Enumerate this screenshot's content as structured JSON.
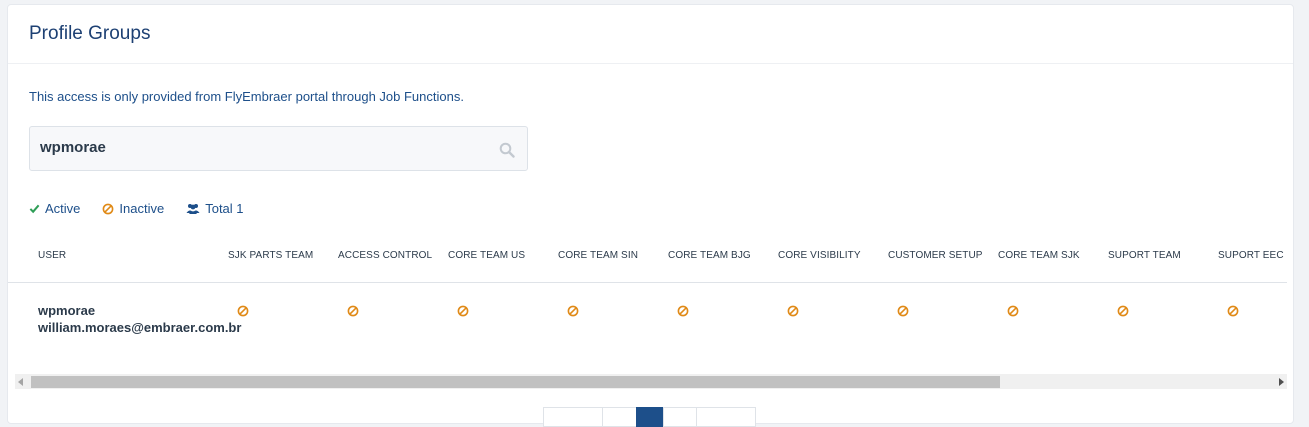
{
  "header": {
    "title": "Profile Groups"
  },
  "notice": "This access is only provided from FlyEmbraer portal through Job Functions.",
  "search": {
    "value": "wpmorae"
  },
  "legend": {
    "active": "Active",
    "inactive": "Inactive",
    "total": "Total 1"
  },
  "colors": {
    "active": "#2f9e57",
    "inactive": "#e08a17",
    "brand": "#1d4073",
    "link": "#1d4f8a"
  },
  "table": {
    "columns": [
      "USER",
      "SJK PARTS TEAM",
      "ACCESS CONTROL",
      "CORE TEAM US",
      "CORE TEAM SIN",
      "CORE TEAM BJG",
      "CORE VISIBILITY",
      "CUSTOMER SETUP",
      "CORE TEAM SJK",
      "SUPORT TEAM",
      "SUPORT EEC"
    ],
    "rows": [
      {
        "user": "wpmorae",
        "email": "william.moraes@embraer.com.br",
        "statuses": [
          "inactive",
          "inactive",
          "inactive",
          "inactive",
          "inactive",
          "inactive",
          "inactive",
          "inactive",
          "inactive",
          "inactive"
        ]
      }
    ]
  },
  "icons": {
    "search": "search-icon",
    "active": "check-icon",
    "inactive": "ban-icon",
    "total": "users-icon"
  }
}
